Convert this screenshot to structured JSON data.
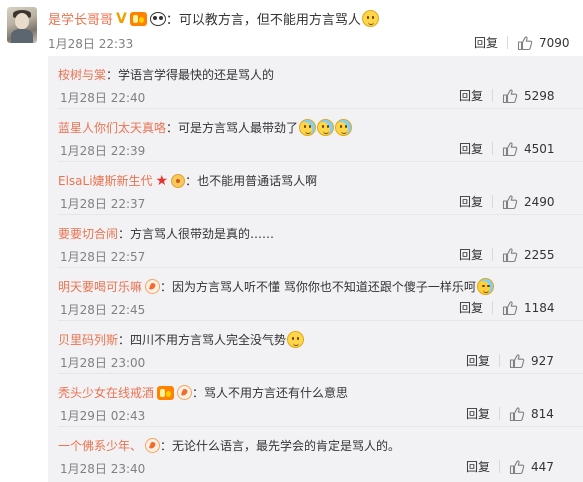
{
  "main": {
    "username": "是学长哥哥",
    "text": "：可以教方言，但不能用方言骂人",
    "date": "1月28日 22:33",
    "reply_label": "回复",
    "likes": "7090"
  },
  "replies": [
    {
      "username": "桉树与棠",
      "text": "：学语言学得最快的还是骂人的",
      "date": "1月28日 22:40",
      "reply_label": "回复",
      "likes": "5298"
    },
    {
      "username": "蓝星人你们太天真咯",
      "text": "：可是方言骂人最带劲了",
      "date": "1月28日 22:39",
      "reply_label": "回复",
      "likes": "4501"
    },
    {
      "username": "ElsaLi婕斯新生代",
      "text": "：也不能用普通话骂人啊",
      "date": "1月28日 22:37",
      "reply_label": "回复",
      "likes": "2490"
    },
    {
      "username": "要要切合闹",
      "text": "：方言骂人很带劲是真的……",
      "date": "1月28日 22:57",
      "reply_label": "回复",
      "likes": "2255"
    },
    {
      "username": "明天要喝可乐嘛",
      "text": "：因为方言骂人听不懂 骂你你也不知道还跟个傻子一样乐呵",
      "date": "1月28日 22:45",
      "reply_label": "回复",
      "likes": "1184"
    },
    {
      "username": "贝里码列斯",
      "text": "：四川不用方言骂人完全没气势",
      "date": "1月28日 23:00",
      "reply_label": "回复",
      "likes": "927"
    },
    {
      "username": "秃头少女在线戒酒",
      "text": "：骂人不用方言还有什么意思",
      "date": "1月29日 02:43",
      "reply_label": "回复",
      "likes": "814"
    },
    {
      "username": "一个佛系少年、",
      "text": "：无论什么语言，最先学会的肯定是骂人的。",
      "date": "1月28日 23:40",
      "reply_label": "回复",
      "likes": "447"
    }
  ],
  "icons": {
    "like": "thumbs-up-icon",
    "verified": "verified-v-icon",
    "vip": "vip-badge-icon",
    "panda": "panda-badge-icon",
    "fan": "fan-badge-icon",
    "star": "star-badge-icon",
    "flower": "flower-badge-icon"
  },
  "colors": {
    "username": "#eb7350",
    "text": "#333333",
    "date": "#808080",
    "reply_bg": "#f2f2f5"
  }
}
